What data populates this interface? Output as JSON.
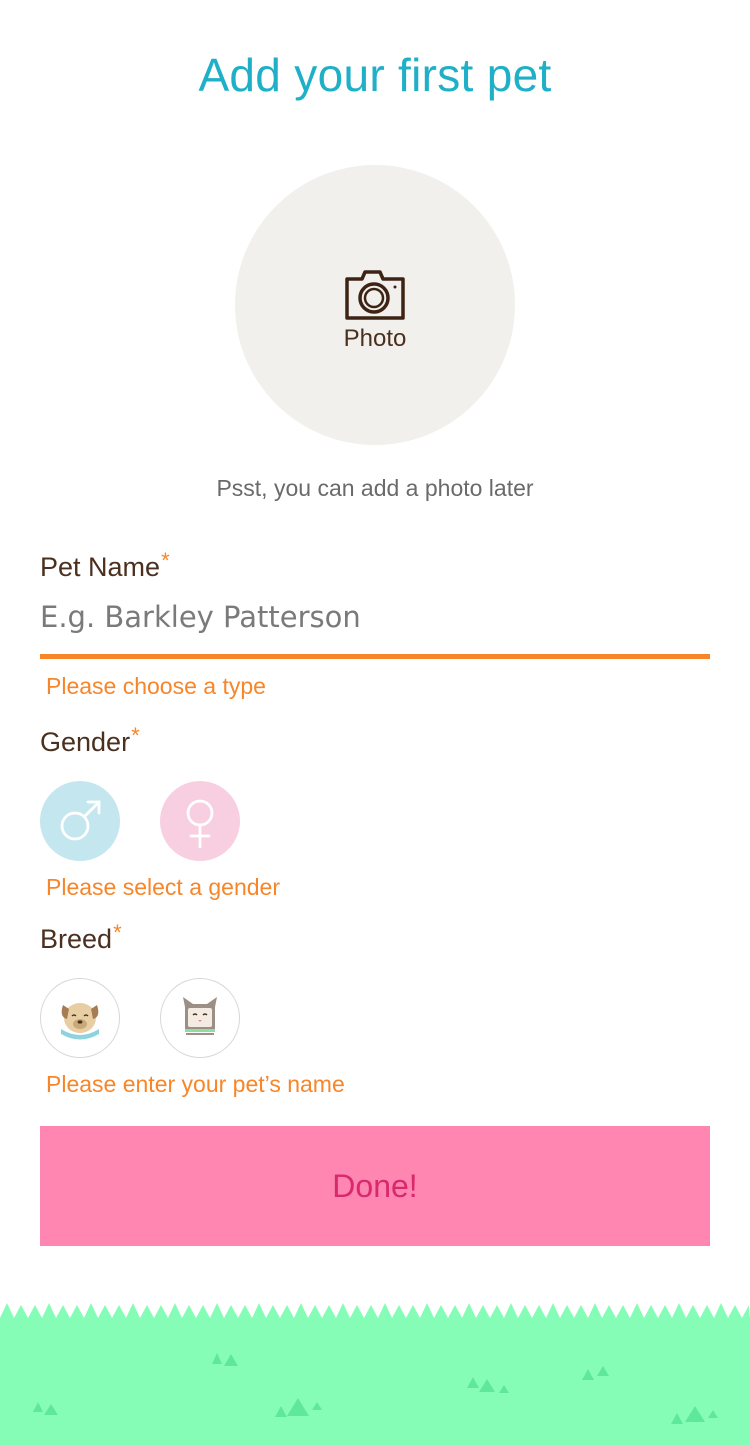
{
  "header": {
    "title": "Add your first pet"
  },
  "photo": {
    "label": "Photo",
    "hint": "Psst, you can add a photo later",
    "icon": "camera-icon"
  },
  "pet_name": {
    "label": "Pet Name",
    "required_mark": "*",
    "placeholder": "E.g. Barkley Patterson",
    "error": "Please choose a type"
  },
  "gender": {
    "label": "Gender",
    "required_mark": "*",
    "options": [
      "male",
      "female"
    ],
    "error": "Please select a gender"
  },
  "breed": {
    "label": "Breed",
    "required_mark": "*",
    "options": [
      "dog",
      "cat"
    ],
    "error": "Please enter your pet’s name"
  },
  "done_button": {
    "label": "Done!"
  },
  "colors": {
    "title": "#1fb0c8",
    "accent": "#f7862a",
    "button": "#ff86b0",
    "button_text": "#d9286b",
    "grass": "#86fdb7",
    "male": "#c4e6ef",
    "female": "#f7cfe1"
  }
}
